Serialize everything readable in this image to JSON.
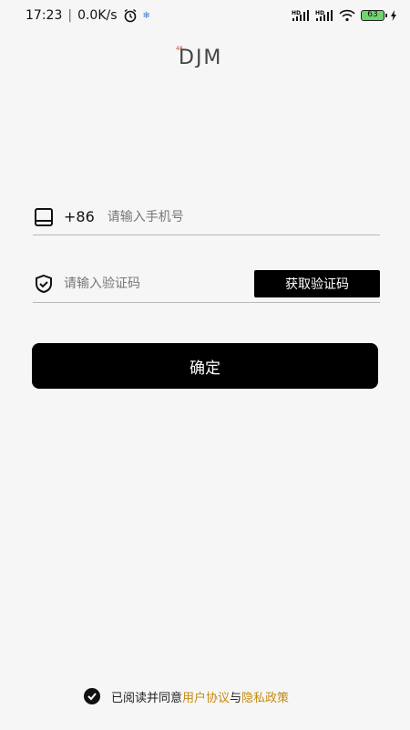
{
  "status_bar": {
    "time": "17:23",
    "network_speed": "0.0K/s",
    "battery": "63",
    "icons": [
      "alarm-icon",
      "snowflake-icon",
      "hd-signal-icon",
      "hd-signal-icon",
      "wifi-icon",
      "battery-icon",
      "charging-icon"
    ]
  },
  "logo": {
    "text": "DJM",
    "sup": "48"
  },
  "phone": {
    "prefix": "+86",
    "placeholder": "请输入手机号",
    "value": ""
  },
  "code": {
    "placeholder": "请输入验证码",
    "value": "",
    "get_code_label": "获取验证码"
  },
  "confirm_label": "确定",
  "agreement": {
    "text": "已阅读并同意",
    "user_agreement": "用户协议",
    "and": "与",
    "privacy_policy": "隐私政策",
    "checked": true
  },
  "colors": {
    "background": "#f6f6f6",
    "primary": "#000000",
    "link": "#c58a12"
  }
}
